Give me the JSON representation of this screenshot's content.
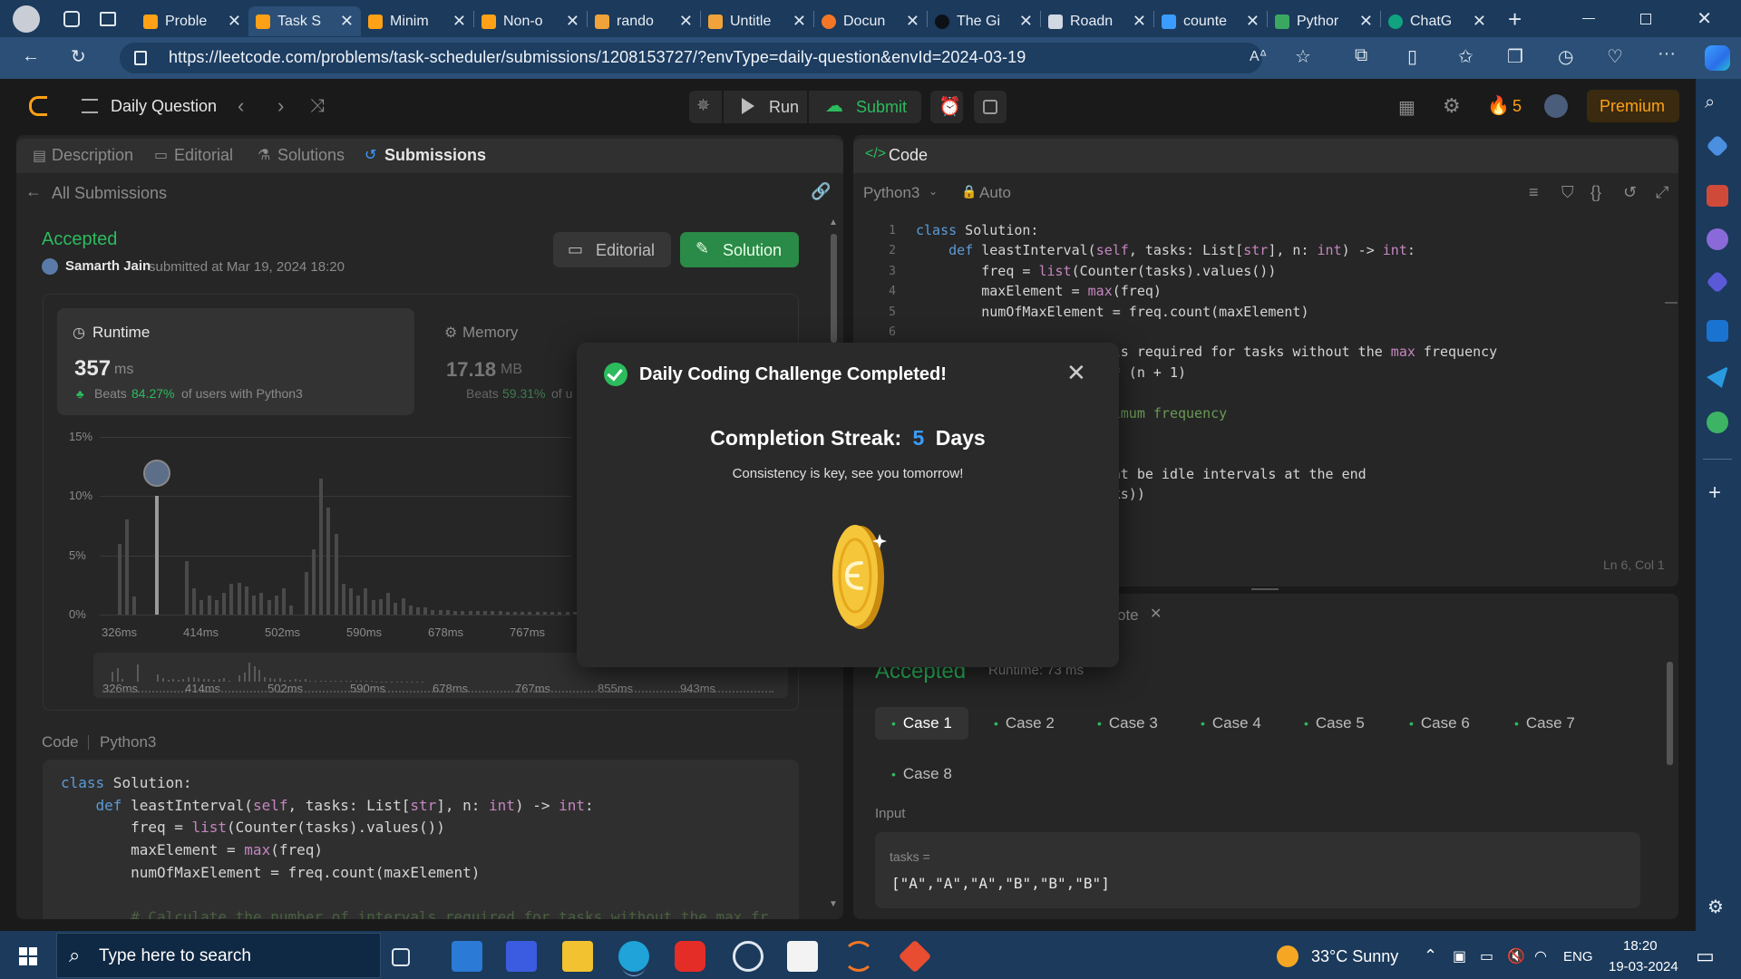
{
  "browser": {
    "tabs": [
      {
        "title": "Proble",
        "icon": "leetcode-icon"
      },
      {
        "title": "Task S",
        "icon": "leetcode-icon",
        "active": true
      },
      {
        "title": "Minim",
        "icon": "leetcode-icon"
      },
      {
        "title": "Non-o",
        "icon": "leetcode-icon"
      },
      {
        "title": "rando",
        "icon": "book-icon"
      },
      {
        "title": "Untitle",
        "icon": "book-icon"
      },
      {
        "title": "Docun",
        "icon": "spinner-icon"
      },
      {
        "title": "The Gi",
        "icon": "github-icon"
      },
      {
        "title": "Roadn",
        "icon": "bell-icon"
      },
      {
        "title": "counte",
        "icon": "search-icon"
      },
      {
        "title": "Pythor",
        "icon": "python-icon"
      },
      {
        "title": "ChatG",
        "icon": "chatgpt-icon"
      }
    ],
    "url": "https://leetcode.com/problems/task-scheduler/submissions/1208153727/?envType=daily-question&envId=2024-03-19"
  },
  "lc_nav": {
    "title": "Daily Question",
    "run": "Run",
    "submit": "Submit",
    "streak": "5",
    "premium": "Premium"
  },
  "left_panel": {
    "tabs": [
      "Description",
      "Editorial",
      "Solutions",
      "Submissions"
    ],
    "back": "All Submissions",
    "status": "Accepted",
    "user": "Samarth Jain",
    "submitted": "submitted at Mar 19, 2024 18:20",
    "editorial_btn": "Editorial",
    "solution_btn": "Solution",
    "runtime_label": "Runtime",
    "runtime_value": "357",
    "runtime_unit": "ms",
    "runtime_beats_prefix": "Beats",
    "runtime_beats": "84.27%",
    "runtime_beats_suffix": "of users with Python3",
    "memory_label": "Memory",
    "memory_value": "17.18",
    "memory_unit": "MB",
    "memory_beats_prefix": "Beats",
    "memory_beats": "59.31%",
    "memory_beats_suffix": "of u",
    "code_label": "Code",
    "lang_label": "Python3"
  },
  "chart_data": {
    "type": "bar",
    "y_ticks": [
      "15%",
      "10%",
      "5%",
      "0%"
    ],
    "x_ticks": [
      "326ms",
      "414ms",
      "502ms",
      "590ms",
      "678ms",
      "767ms"
    ],
    "mini_ticks": [
      "326ms",
      "414ms",
      "502ms",
      "590ms",
      "678ms",
      "767ms",
      "855ms",
      "943ms"
    ],
    "values": [
      6,
      8,
      1.5,
      0,
      0,
      10,
      0,
      0,
      0,
      4.5,
      2.2,
      1.2,
      1.6,
      1.2,
      1.8,
      2.6,
      2.7,
      2.4,
      1.6,
      1.8,
      1.2,
      1.6,
      2.2,
      0.8,
      0,
      3.6,
      5.5,
      11.5,
      9,
      6.8,
      2.6,
      2.2,
      1.6,
      2.2,
      1.2,
      1.3,
      1.8,
      1,
      1.4,
      0.8,
      0.6,
      0.6,
      0.4,
      0.4,
      0.4,
      0.3,
      0.3,
      0.3,
      0.3,
      0.3,
      0.3,
      0.3,
      0.2,
      0.2,
      0.2,
      0.2,
      0.2,
      0.2,
      0.2,
      0.2,
      0.2,
      0.2
    ],
    "ylim": [
      0,
      15
    ],
    "highlight_index": 5
  },
  "left_code": [
    "class Solution:",
    "    def leastInterval(self, tasks: List[str], n: int) -> int:",
    "        freq = list(Counter(tasks).values())",
    "        maxElement = max(freq)",
    "        numOfMaxElement = freq.count(maxElement)",
    "",
    "        # Calculate the number of intervals required for tasks without the max fr"
  ],
  "right_panel": {
    "title": "Code",
    "lang": "Python3",
    "auto": "Auto",
    "status_bar": "Ln 6, Col 1",
    "code": [
      "class Solution:",
      "    def leastInterval(self, tasks: List[str], n: int) -> int:",
      "        freq = list(Counter(tasks).values())",
      "        maxElement = max(freq)",
      "        numOfMaxElement = freq.count(maxElement)",
      "",
      "        umber of intervals required for tasks without the max frequency",
      "        maxElement - 1) * (n + 1)",
      "",
      "        ith the same maximum frequency",
      "        numOfMaxElement",
      "",
      "         where there might be idle intervals at the end",
      "        tervals, len(tasks))"
    ],
    "line_numbers": [
      "1",
      "2",
      "3",
      "4",
      "5",
      "6"
    ]
  },
  "test_panel": {
    "tab_fragment": "ote",
    "accepted": "Accepted",
    "runtime_note": "Runtime: 73 ms",
    "cases": [
      "Case 1",
      "Case 2",
      "Case 3",
      "Case 4",
      "Case 5",
      "Case 6",
      "Case 7",
      "Case 8"
    ],
    "input_label": "Input",
    "var_name": "tasks =",
    "var_value": "[\"A\",\"A\",\"A\",\"B\",\"B\",\"B\"]"
  },
  "modal": {
    "title": "Daily Coding Challenge Completed!",
    "streak_label": "Completion Streak:",
    "streak_value": "5",
    "streak_unit": "Days",
    "message": "Consistency is key, see you tomorrow!"
  },
  "taskbar": {
    "search_placeholder": "Type here to search",
    "weather": "33°C  Sunny",
    "lang": "ENG",
    "time": "18:20",
    "date": "19-03-2024"
  },
  "colors": {
    "accent_green": "#2cbb5d",
    "streak_blue": "#3b9cff",
    "premium_orange": "#ffa116",
    "browser_blue": "#2b4f76"
  }
}
